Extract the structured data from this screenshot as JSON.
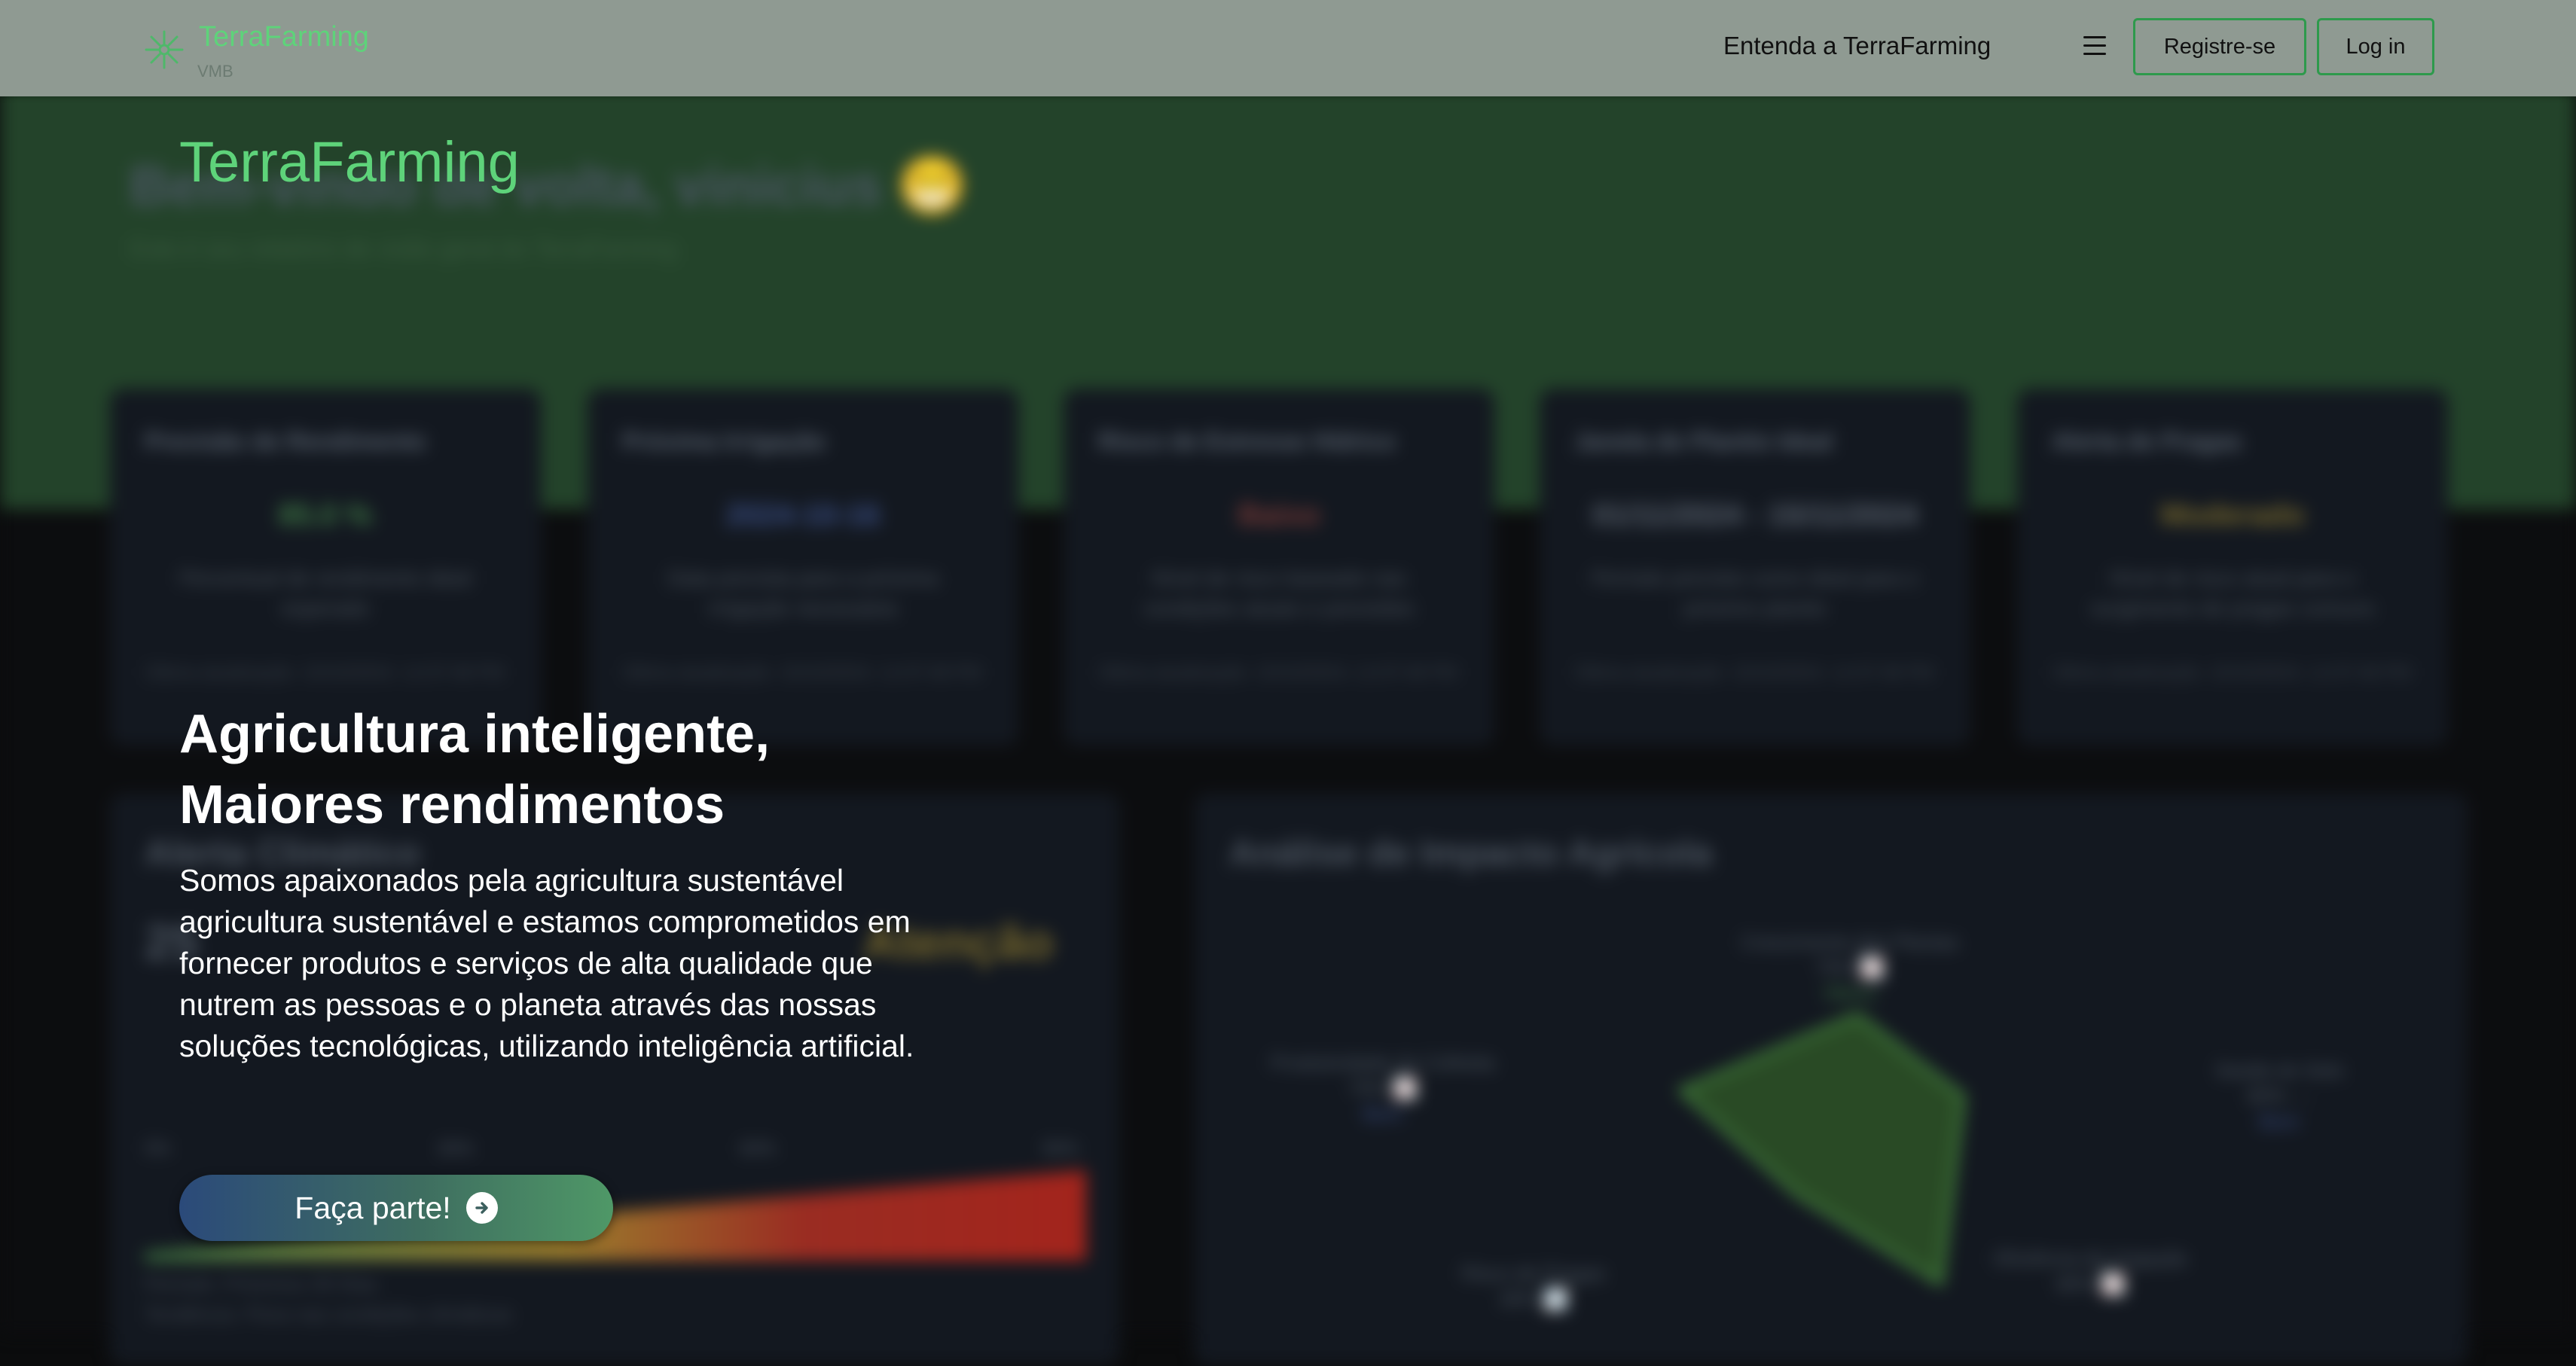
{
  "header": {
    "brand_name": "TerraFarming",
    "brand_sub": "VMB",
    "nav_about": "Entenda a TerraFarming",
    "register_label": "Registre-se",
    "login_label": "Log in"
  },
  "hero": {
    "brand": "TerraFarming",
    "title_line1": "Agricultura inteligente,",
    "title_line2": "Maiores rendimentos",
    "text": "Somos apaixonados pela agricultura sustentável agricultura sustentável e estamos comprometidos em fornecer produtos e serviços de alta qualidade que nutrem as pessoas e o planeta através das nossas soluções tecnológicas, utilizando inteligência artificial.",
    "cta_label": "Faça parte!"
  },
  "background_dashboard": {
    "welcome": "Bem-vindo de volta, vinicius 😁",
    "welcome_sub": "Este é seu relatório de visão geral do TerraFarming",
    "stat_cards": [
      {
        "title": "Previsão de Rendimento",
        "value": "85.0 %",
        "value_color": "#3f7a45",
        "desc": "Percentual de rendimento ideal esperado",
        "updated": "Última atualização: 15/10/2024, 11:07:48 PM"
      },
      {
        "title": "Próxima Irrigação",
        "value": "2024-10-16",
        "value_color": "#3a4f86",
        "desc": "Data prevista para a próxima irrigação necessária",
        "updated": "Última atualização: 15/10/2024, 11:07:48 PM"
      },
      {
        "title": "Risco de Estresse Hídrico",
        "value": "Baixo",
        "value_color": "#7a3a36",
        "desc": "Nível de risco baseado nas condições atuais e previsões",
        "updated": "Última atualização: 15/10/2024, 11:07:48 PM"
      },
      {
        "title": "Janela de Plantio Ideal",
        "value": "01/11/2024 - 15/11/2024",
        "value_color": "#5b6470",
        "desc": "Período previsto como ideal para o próximo plantio",
        "updated": "Última atualização: 15/10/2024, 11:07:48 PM"
      },
      {
        "title": "Alerta de Pragas",
        "value": "Moderado",
        "value_color": "#7a6a2c",
        "desc": "Nível de risco atual para o surgimento de pragas comuns",
        "updated": "Última atualização: 15/10/2024, 11:07:48 PM"
      }
    ],
    "climate_card": {
      "title": "Alerta Climático",
      "value": "25",
      "status": "Atenção",
      "scale": [
        "0%",
        "30%",
        "60%",
        "90%"
      ],
      "period": "Período: Próximos 30 Dias",
      "trend": "Tendência: Piora nas condições climáticas"
    },
    "impact_card": {
      "title": "Análise de Impacto Agrícola",
      "labels": [
        {
          "name": "Crescimento das Plantas",
          "value": "75% 📈",
          "note": "Ótimo"
        },
        {
          "name": "Produtividade da Colheita",
          "value": "70% 📈",
          "note": "Bom"
        },
        {
          "name": "Saúde do Solo",
          "value": "80% →",
          "note": "Bom"
        },
        {
          "name": "Risco de Pragas",
          "value": "30% 📉",
          "note": ""
        },
        {
          "name": "Eficiência da Irrigação",
          "value": "80% 📈",
          "note": ""
        }
      ]
    }
  }
}
